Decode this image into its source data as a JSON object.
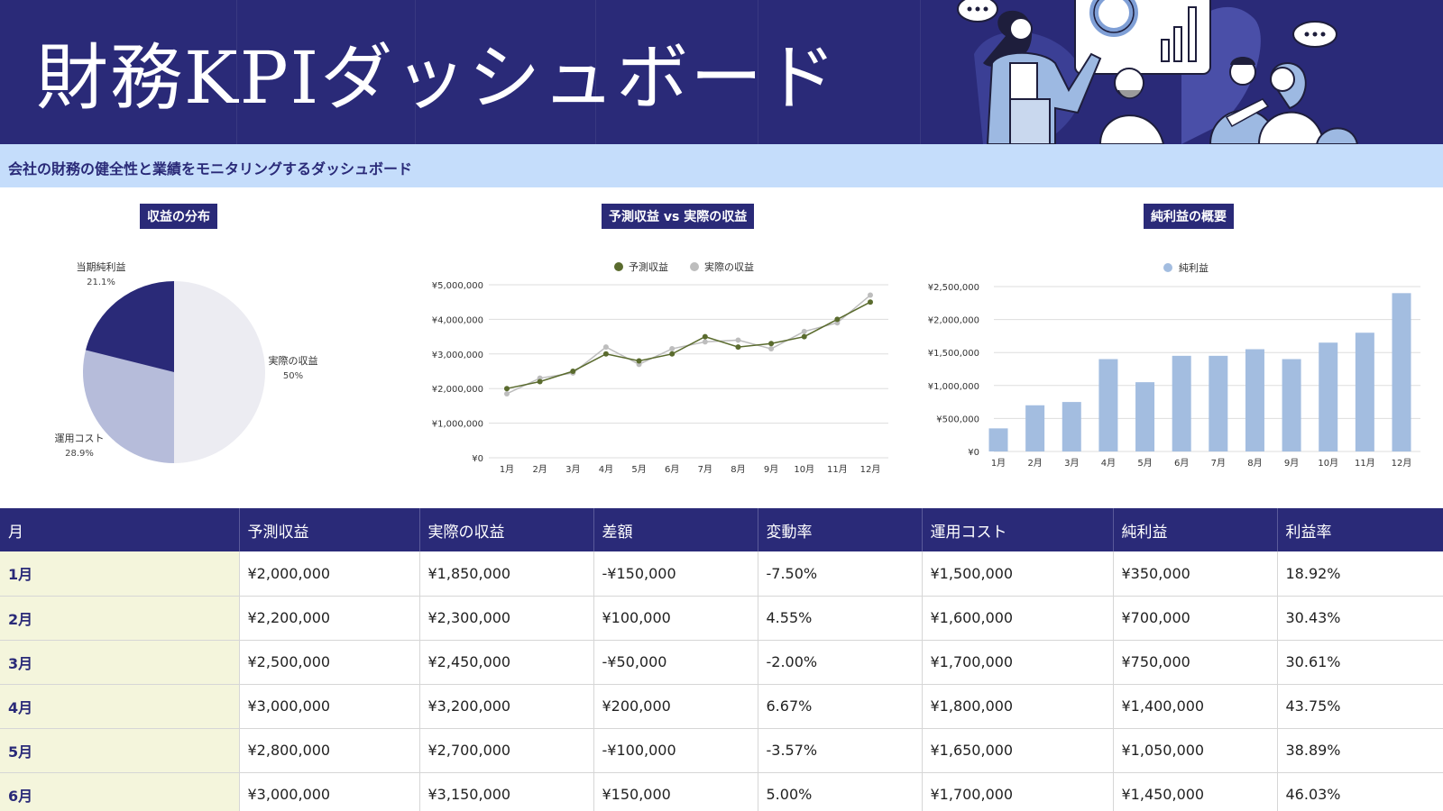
{
  "header": {
    "title": "財務KPIダッシュボード",
    "subtitle": "会社の財務の健全性と業績をモニタリングするダッシュボード"
  },
  "colors": {
    "navy": "#2a2a78",
    "subtitle_bg": "#c5ddfb",
    "month_bg": "#f4f5dc",
    "forecast_line": "#5a6b2e",
    "actual_line": "#bdbdbd",
    "bar": "#a3bde0",
    "pie_actual": "#ececf2",
    "pie_cost": "#b6bcda",
    "pie_profit": "#2a2a78"
  },
  "icons": [
    "speech-bubble-icon",
    "donut-chart-icon",
    "bar-chart-icon",
    "presenter-illustration"
  ],
  "chart_data": [
    {
      "type": "pie",
      "title": "収益の分布",
      "slices": [
        {
          "label": "実際の収益",
          "pct_label": "50%",
          "value": 50,
          "color": "#ececf2"
        },
        {
          "label": "運用コスト",
          "pct_label": "28.9%",
          "value": 28.9,
          "color": "#b6bcda"
        },
        {
          "label": "当期純利益",
          "pct_label": "21.1%",
          "value": 21.1,
          "color": "#2a2a78"
        }
      ]
    },
    {
      "type": "line",
      "title": "予測収益 vs 実際の収益",
      "categories": [
        "1月",
        "2月",
        "3月",
        "4月",
        "5月",
        "6月",
        "7月",
        "8月",
        "9月",
        "10月",
        "11月",
        "12月"
      ],
      "series": [
        {
          "name": "予測収益",
          "color": "#5a6b2e",
          "values": [
            2000000,
            2200000,
            2500000,
            3000000,
            2800000,
            3000000,
            3500000,
            3200000,
            3300000,
            3500000,
            4000000,
            4500000
          ]
        },
        {
          "name": "実際の収益",
          "color": "#bdbdbd",
          "values": [
            1850000,
            2300000,
            2450000,
            3200000,
            2700000,
            3150000,
            3350000,
            3400000,
            3150000,
            3650000,
            3900000,
            4700000
          ]
        }
      ],
      "yticks": [
        "¥0",
        "¥1,000,000",
        "¥2,000,000",
        "¥3,000,000",
        "¥4,000,000",
        "¥5,000,000"
      ],
      "ylim": [
        0,
        5000000
      ],
      "legend": "top",
      "grid": true
    },
    {
      "type": "bar",
      "title": "純利益の概要",
      "categories": [
        "1月",
        "2月",
        "3月",
        "4月",
        "5月",
        "6月",
        "7月",
        "8月",
        "9月",
        "10月",
        "11月",
        "12月"
      ],
      "series": [
        {
          "name": "純利益",
          "color": "#a3bde0",
          "values": [
            350000,
            700000,
            750000,
            1400000,
            1050000,
            1450000,
            1450000,
            1550000,
            1400000,
            1650000,
            1800000,
            2400000
          ]
        }
      ],
      "yticks": [
        "¥0",
        "¥500,000",
        "¥1,000,000",
        "¥1,500,000",
        "¥2,000,000",
        "¥2,500,000"
      ],
      "ylim": [
        0,
        2500000
      ],
      "legend": "top",
      "grid": true
    }
  ],
  "table": {
    "headers": [
      "月",
      "予測収益",
      "実際の収益",
      "差額",
      "変動率",
      "運用コスト",
      "純利益",
      "利益率"
    ],
    "rows": [
      [
        "1月",
        "¥2,000,000",
        "¥1,850,000",
        "-¥150,000",
        "-7.50%",
        "¥1,500,000",
        "¥350,000",
        "18.92%"
      ],
      [
        "2月",
        "¥2,200,000",
        "¥2,300,000",
        "¥100,000",
        "4.55%",
        "¥1,600,000",
        "¥700,000",
        "30.43%"
      ],
      [
        "3月",
        "¥2,500,000",
        "¥2,450,000",
        "-¥50,000",
        "-2.00%",
        "¥1,700,000",
        "¥750,000",
        "30.61%"
      ],
      [
        "4月",
        "¥3,000,000",
        "¥3,200,000",
        "¥200,000",
        "6.67%",
        "¥1,800,000",
        "¥1,400,000",
        "43.75%"
      ],
      [
        "5月",
        "¥2,800,000",
        "¥2,700,000",
        "-¥100,000",
        "-3.57%",
        "¥1,650,000",
        "¥1,050,000",
        "38.89%"
      ],
      [
        "6月",
        "¥3,000,000",
        "¥3,150,000",
        "¥150,000",
        "5.00%",
        "¥1,700,000",
        "¥1,450,000",
        "46.03%"
      ]
    ]
  }
}
